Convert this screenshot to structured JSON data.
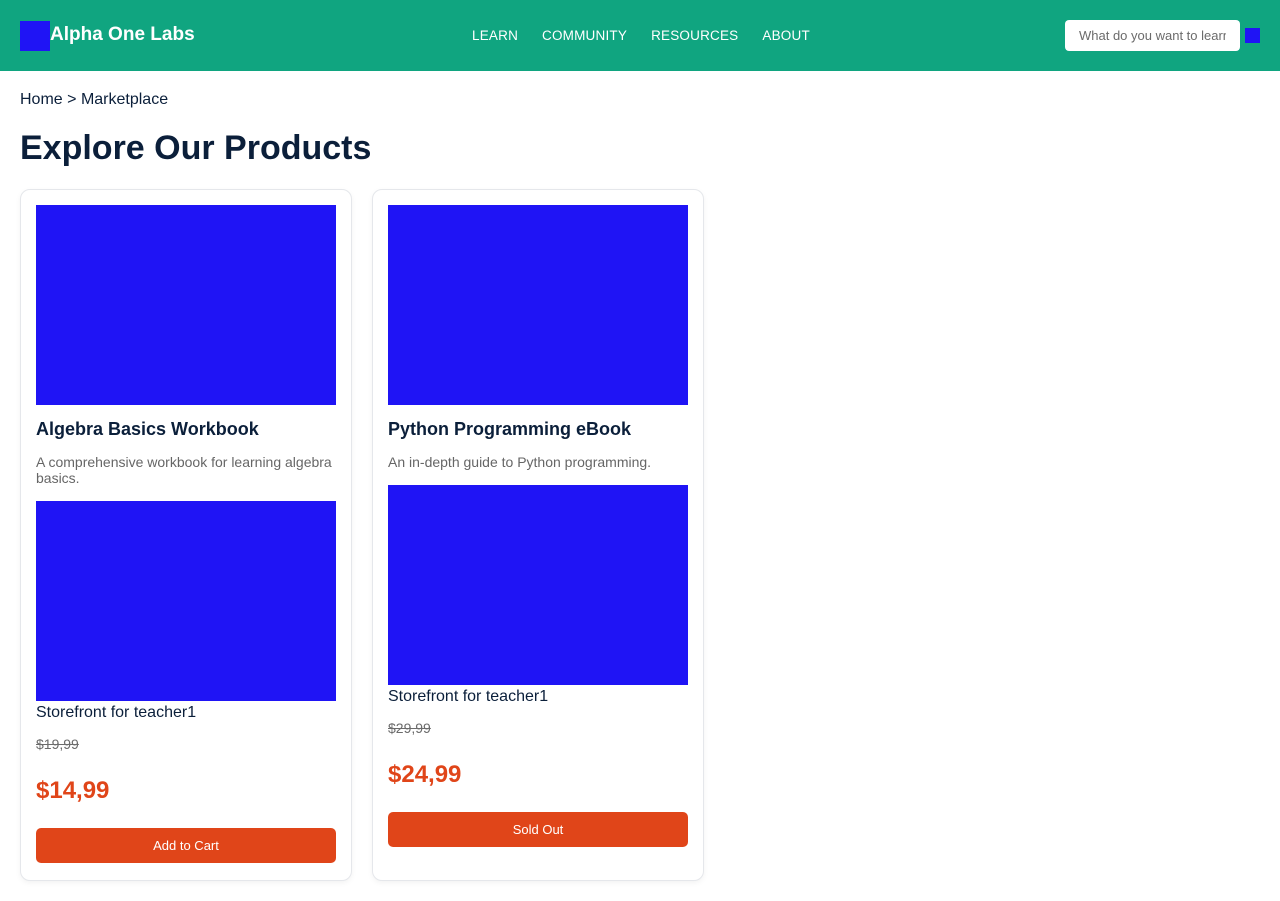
{
  "header": {
    "brand": "Alpha One Labs",
    "nav": [
      "LEARN",
      "COMMUNITY",
      "RESOURCES",
      "ABOUT"
    ],
    "search_placeholder": "What do you want to learn?",
    "accent_color": "#10a580",
    "placeholder_image_color": "#1f14f5"
  },
  "breadcrumb": {
    "home": "Home",
    "separator": ">",
    "current": "Marketplace"
  },
  "page": {
    "title": "Explore Our Products"
  },
  "products": [
    {
      "title": "Algebra Basics Workbook",
      "description": "A comprehensive workbook for learning algebra basics.",
      "storefront": "Storefront for teacher1",
      "old_price": "$19,99",
      "price": "$14,99",
      "button": "Add to Cart"
    },
    {
      "title": "Python Programming eBook",
      "description": "An in-depth guide to Python programming.",
      "storefront": "Storefront for teacher1",
      "old_price": "$29,99",
      "price": "$24,99",
      "button": "Sold Out"
    }
  ],
  "price_color": "#e04519"
}
